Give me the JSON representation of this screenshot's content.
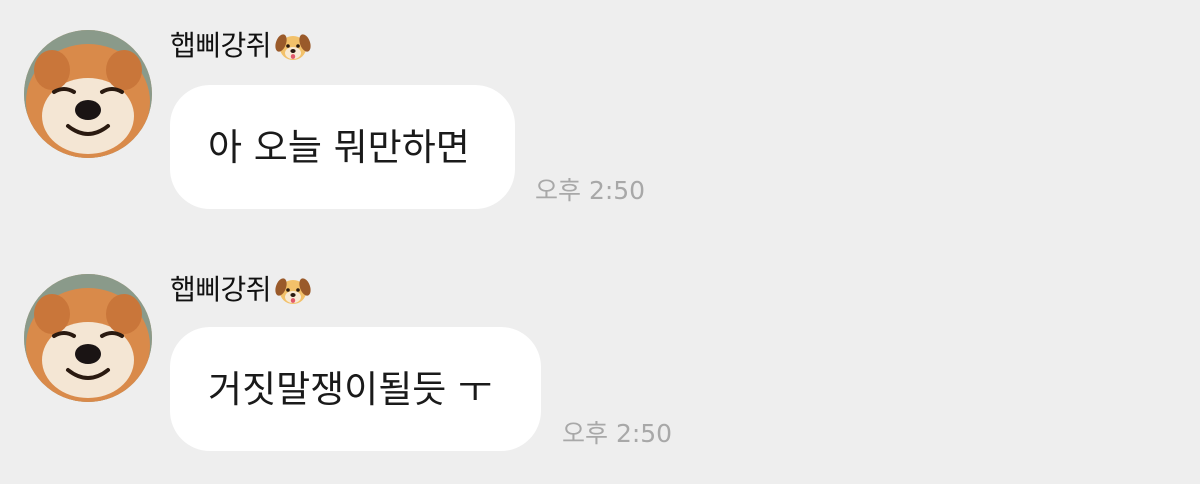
{
  "messages": [
    {
      "sender": "햅삐강쥐",
      "sender_emoji": "dog-face-emoji",
      "text": "아 오늘 뭐만하면",
      "time": "오후 2:50"
    },
    {
      "sender": "햅삐강쥐",
      "sender_emoji": "dog-face-emoji",
      "text": "거짓말쟁이될듯 ㅜ",
      "time": "오후 2:50"
    }
  ],
  "colors": {
    "background": "#eeeeee",
    "bubble": "#ffffff",
    "timestamp": "#a8a8a8"
  }
}
